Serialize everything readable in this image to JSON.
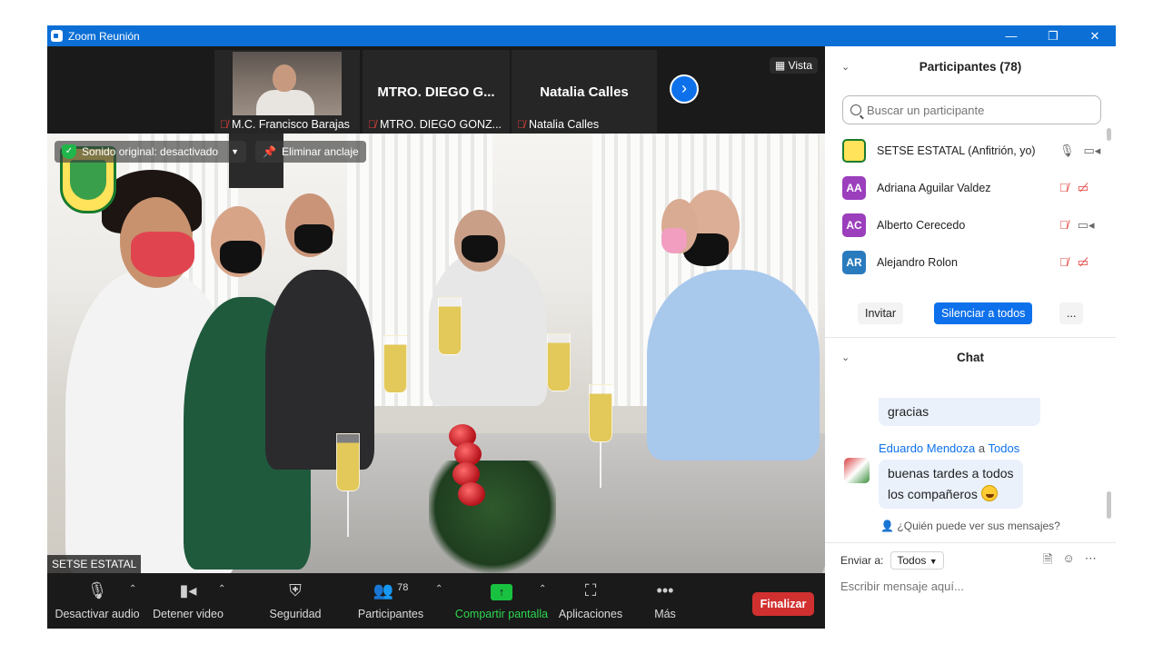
{
  "window": {
    "title": "Zoom Reunión",
    "controls": [
      "minimize",
      "restore",
      "close"
    ]
  },
  "strip": {
    "thumbnails": [
      {
        "name": "M.C. Francisco Barajas",
        "has_video": true,
        "muted": true
      },
      {
        "name_big": "MTRO. DIEGO G...",
        "name": "MTRO. DIEGO GONZ...",
        "has_video": false,
        "muted": true
      },
      {
        "name_big": "Natalia Calles",
        "name": "Natalia Calles",
        "has_video": false,
        "muted": true
      }
    ],
    "vista_label": "Vista"
  },
  "main_video": {
    "original_sound": "Sonido original: desactivado",
    "unpin": "Eliminar anclaje",
    "speaker_name": "SETSE ESTATAL"
  },
  "toolbar": {
    "mute_audio": "Desactivar audio",
    "stop_video": "Detener video",
    "security": "Seguridad",
    "participants": "Participantes",
    "participants_count": "78",
    "share_screen": "Compartir pantalla",
    "apps": "Aplicaciones",
    "more": "Más",
    "end": "Finalizar"
  },
  "participants_panel": {
    "title": "Participantes (78)",
    "search_placeholder": "Buscar un participante",
    "items": [
      {
        "name": "SETSE ESTATAL (Anfitrión, yo)",
        "initials": "",
        "avatar_color": "#ffe35a",
        "mic": "on",
        "cam": "on"
      },
      {
        "name": "Adriana Aguilar Valdez",
        "initials": "AA",
        "avatar_color": "#9b3fbd",
        "mic": "off",
        "cam": "off"
      },
      {
        "name": "Alberto Cerecedo",
        "initials": "AC",
        "avatar_color": "#9b3fbd",
        "mic": "off",
        "cam": "on"
      },
      {
        "name": "Alejandro Rolon",
        "initials": "AR",
        "avatar_color": "#2a7bbd",
        "mic": "off",
        "cam": "off"
      }
    ],
    "invite": "Invitar",
    "mute_all": "Silenciar a todos",
    "more": "..."
  },
  "chat": {
    "title": "Chat",
    "prev_message": "gracias",
    "sender": "Eduardo Mendoza",
    "to_word": "a",
    "recipient": "Todos",
    "message_line1": "buenas tardes a todos",
    "message_line2": "los compañeros",
    "who_can_see": "¿Quién puede ver sus mensajes?",
    "send_to_label": "Enviar a:",
    "send_to_value": "Todos",
    "input_placeholder": "Escribir mensaje aquí..."
  }
}
